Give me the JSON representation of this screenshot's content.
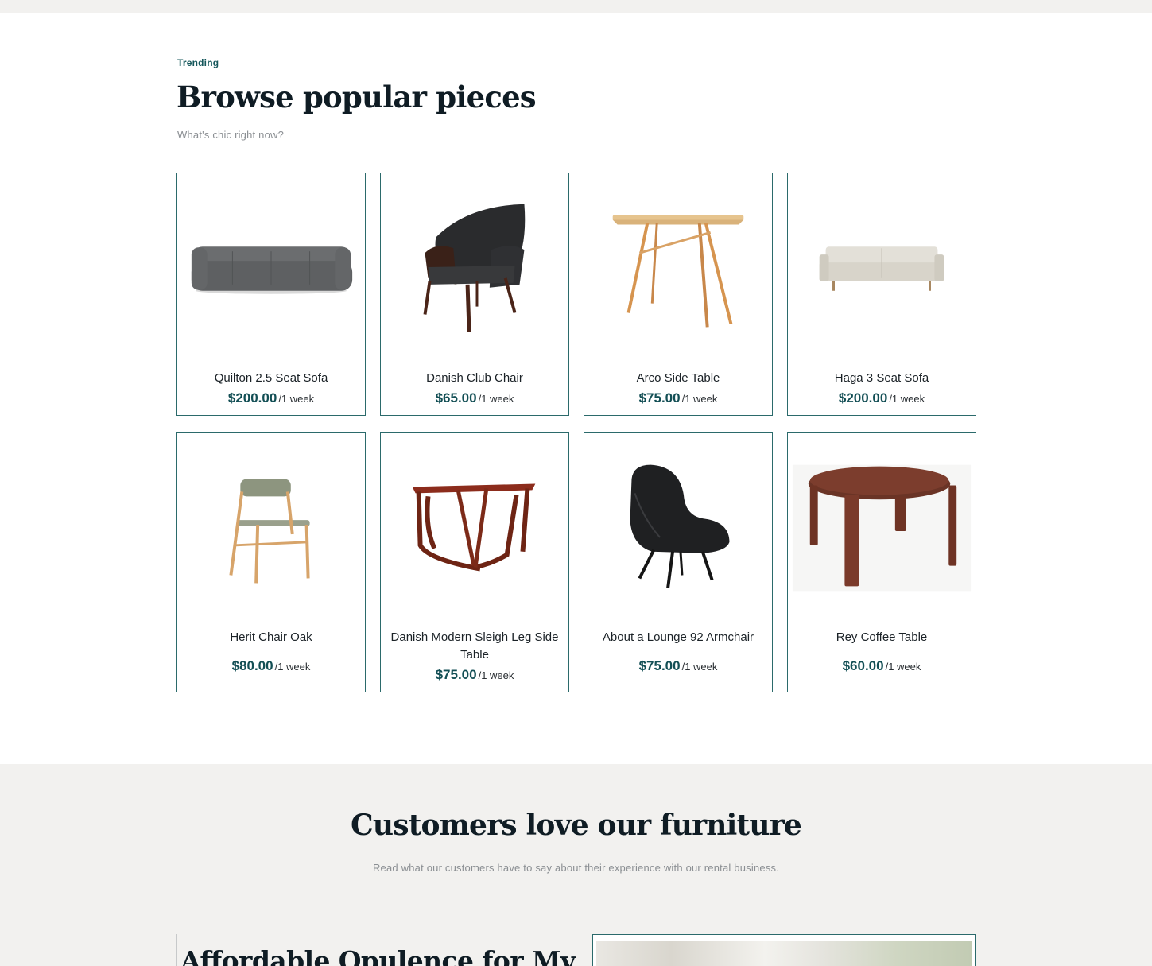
{
  "trending": {
    "eyebrow": "Trending",
    "title": "Browse popular pieces",
    "subtitle": "What's chic right now?"
  },
  "products": [
    {
      "name": "Quilton 2.5 Seat Sofa",
      "price": "$200.00",
      "period": "/1 week",
      "image_icon": "sofa-grey-icon"
    },
    {
      "name": "Danish Club Chair",
      "price": "$65.00",
      "period": "/1 week",
      "image_icon": "club-chair-icon"
    },
    {
      "name": "Arco Side Table",
      "price": "$75.00",
      "period": "/1 week",
      "image_icon": "side-table-icon"
    },
    {
      "name": "Haga 3 Seat Sofa",
      "price": "$200.00",
      "period": "/1 week",
      "image_icon": "sofa-cream-icon"
    },
    {
      "name": "Herit Chair Oak",
      "price": "$80.00",
      "period": "/1 week",
      "image_icon": "dining-chair-icon"
    },
    {
      "name": "Danish Modern Sleigh Leg Side Table",
      "price": "$75.00",
      "period": "/1 week",
      "image_icon": "sleigh-table-icon"
    },
    {
      "name": "About a Lounge 92 Armchair",
      "price": "$75.00",
      "period": "/1 week",
      "image_icon": "lounge-chair-icon"
    },
    {
      "name": "Rey Coffee Table",
      "price": "$60.00",
      "period": "/1 week",
      "image_icon": "coffee-table-icon"
    }
  ],
  "reviews": {
    "title": "Customers love our furniture",
    "subtitle": "Read what our customers have to say about their experience with our rental business.",
    "first_heading": "Affordable Opulence for My"
  },
  "colors": {
    "accent": "#134f55",
    "card_border": "#2b6a6b",
    "band_background": "#f2f1ef"
  }
}
